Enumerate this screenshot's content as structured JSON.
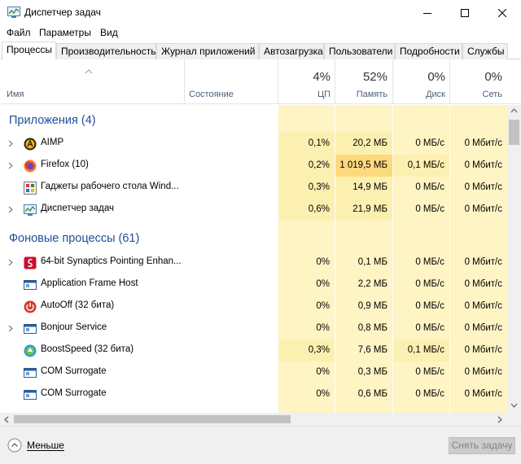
{
  "window": {
    "title": "Диспетчер задач"
  },
  "menu": [
    "Файл",
    "Параметры",
    "Вид"
  ],
  "tabs": [
    "Процессы",
    "Производительность",
    "Журнал приложений",
    "Автозагрузка",
    "Пользователи",
    "Подробности",
    "Службы"
  ],
  "header": {
    "name": "Имя",
    "state": "Состояние",
    "cols": [
      {
        "pct": "4%",
        "label": "ЦП"
      },
      {
        "pct": "52%",
        "label": "Память"
      },
      {
        "pct": "0%",
        "label": "Диск"
      },
      {
        "pct": "0%",
        "label": "Сеть"
      }
    ]
  },
  "groups": {
    "apps": "Приложения (4)",
    "background": "Фоновые процессы (61)"
  },
  "rows": [
    {
      "name": "AIMP",
      "icon": "aimp-icon",
      "cpu": "0,1%",
      "mem": "20,2 МБ",
      "disk": "0 МБ/с",
      "net": "0 Мбит/с"
    },
    {
      "name": "Firefox (10)",
      "icon": "firefox-icon",
      "cpu": "0,2%",
      "mem": "1 019,5 МБ",
      "disk": "0,1 МБ/с",
      "net": "0 Мбит/с"
    },
    {
      "name": "Гаджеты рабочего стола Wind...",
      "icon": "gadgets-icon",
      "cpu": "0,3%",
      "mem": "14,9 МБ",
      "disk": "0 МБ/с",
      "net": "0 Мбит/с"
    },
    {
      "name": "Диспетчер задач",
      "icon": "task-manager-icon",
      "cpu": "0,6%",
      "mem": "21,9 МБ",
      "disk": "0 МБ/с",
      "net": "0 Мбит/с"
    },
    {
      "name": "64-bit Synaptics Pointing Enhan...",
      "icon": "synaptics-icon",
      "cpu": "0%",
      "mem": "0,1 МБ",
      "disk": "0 МБ/с",
      "net": "0 Мбит/с"
    },
    {
      "name": "Application Frame Host",
      "icon": "app-window-icon",
      "cpu": "0%",
      "mem": "2,2 МБ",
      "disk": "0 МБ/с",
      "net": "0 Мбит/с"
    },
    {
      "name": "AutoOff (32 бита)",
      "icon": "power-icon",
      "cpu": "0%",
      "mem": "0,9 МБ",
      "disk": "0 МБ/с",
      "net": "0 Мбит/с"
    },
    {
      "name": "Bonjour Service",
      "icon": "service-icon",
      "cpu": "0%",
      "mem": "0,8 МБ",
      "disk": "0 МБ/с",
      "net": "0 Мбит/с"
    },
    {
      "name": "BoostSpeed (32 бита)",
      "icon": "boostspeed-icon",
      "cpu": "0,3%",
      "mem": "7,6 МБ",
      "disk": "0,1 МБ/с",
      "net": "0 Мбит/с"
    },
    {
      "name": "COM Surrogate",
      "icon": "app-window-icon",
      "cpu": "0%",
      "mem": "0,3 МБ",
      "disk": "0 МБ/с",
      "net": "0 Мбит/с"
    },
    {
      "name": "COM Surrogate",
      "icon": "app-window-icon",
      "cpu": "0%",
      "mem": "0,6 МБ",
      "disk": "0 МБ/с",
      "net": "0 Мбит/с"
    }
  ],
  "footer": {
    "less": "Меньше",
    "end_task": "Снять задачу"
  },
  "colors": {
    "heat_light": "#fff4c4",
    "heat_medium": "#fcf0b0",
    "heat_high": "#fdd97e",
    "group_title": "#1f4e9a"
  }
}
